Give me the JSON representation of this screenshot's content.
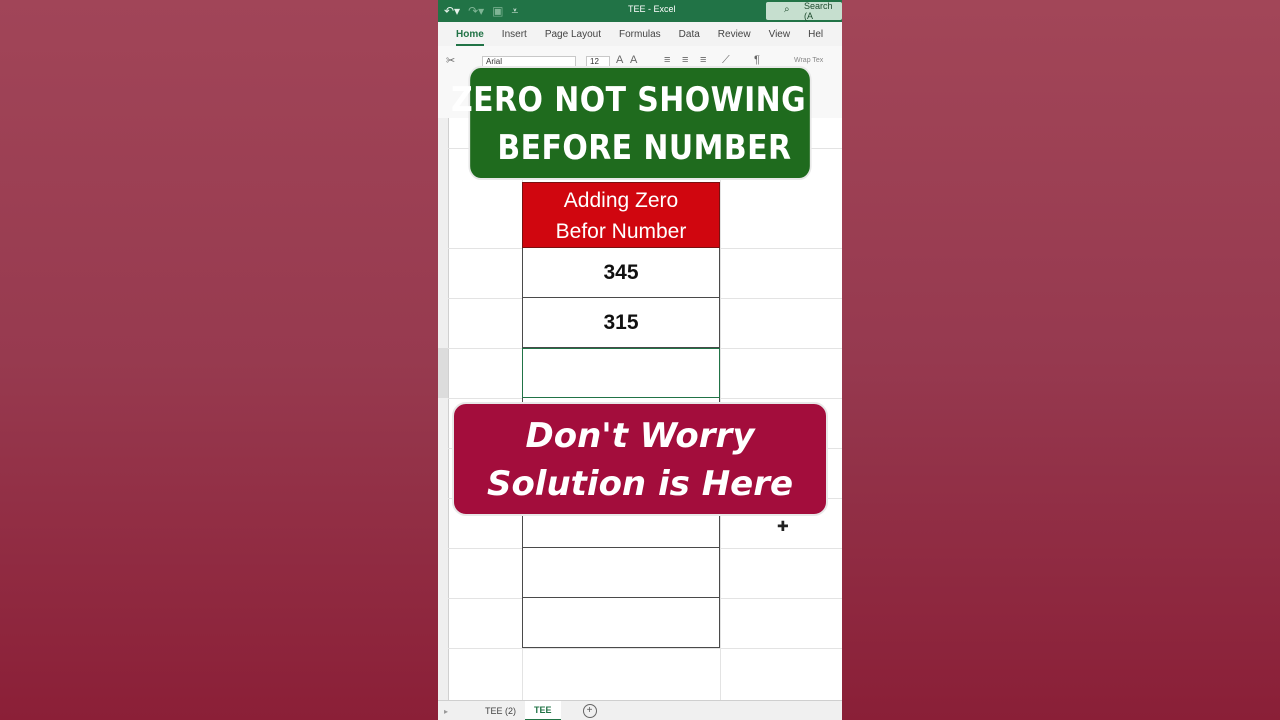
{
  "window": {
    "title": "TEE  -  Excel",
    "search_label": "Search (A"
  },
  "ribbon": {
    "tabs": [
      "Home",
      "Insert",
      "Page Layout",
      "Formulas",
      "Data",
      "Review",
      "View",
      "Hel"
    ],
    "active_tab": "Home",
    "font_name": "Arial",
    "font_size": "12",
    "wrap_text": "Wrap Tex"
  },
  "sheet": {
    "header": "Adding Zero\nBefor Number",
    "header_line1": "Adding Zero",
    "header_line2": "Befor Number",
    "rows": [
      "345",
      "315",
      "",
      "",
      "",
      "",
      "",
      ""
    ],
    "colors": {
      "header_bg": "#d0060f",
      "excel_green": "#217346"
    }
  },
  "sheet_tabs": {
    "tabs": [
      "TEE (2)",
      "TEE"
    ],
    "active": "TEE",
    "add_icon": "plus-circle-icon"
  },
  "overlay": {
    "top_line1": "ZERO NOT SHOWING",
    "top_line2": "BEFORE NUMBER",
    "bottom_line1": "Don't Worry",
    "bottom_line2": "Solution is Here",
    "colors": {
      "top_bg": "#1f6b1e",
      "bottom_bg": "#a30d3c"
    }
  }
}
